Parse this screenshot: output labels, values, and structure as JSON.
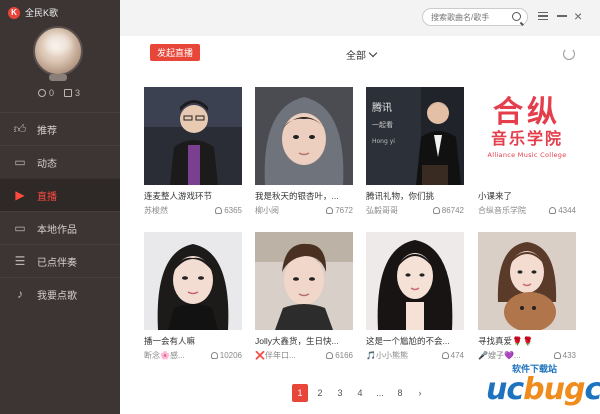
{
  "app": {
    "title": "全民K歌"
  },
  "profile": {
    "stats": [
      {
        "icon": "coin-icon",
        "value": "0"
      },
      {
        "icon": "flower-icon",
        "value": "3"
      }
    ]
  },
  "nav": [
    {
      "label": "推荐",
      "icon": "thumb-up-icon",
      "active": false
    },
    {
      "label": "动态",
      "icon": "chat-icon",
      "active": false
    },
    {
      "label": "直播",
      "icon": "live-video-icon",
      "active": true
    },
    {
      "label": "本地作品",
      "icon": "monitor-icon",
      "active": false
    },
    {
      "label": "已点伴奏",
      "icon": "list-icon",
      "active": false
    },
    {
      "label": "我要点歌",
      "icon": "mic-icon",
      "active": false
    }
  ],
  "search": {
    "placeholder": "搜索歌曲名/歌手"
  },
  "toolbar": {
    "live_button": "发起直播",
    "filter": "全部"
  },
  "cards": [
    {
      "title": "连麦整人游戏环节",
      "user": "苏梭然",
      "count": "6365"
    },
    {
      "title": "我是秋天的银杏叶，...",
      "user": "柳小阅",
      "count": "7672"
    },
    {
      "title": "腾讯礼物，你们挑",
      "user": "弘毅哥哥",
      "count": "86742"
    },
    {
      "title": "小课来了",
      "user": "合纵音乐学院",
      "count": "4344"
    },
    {
      "title": "播一会有人嘛",
      "user": "断念🌸感...",
      "count": "10206"
    },
    {
      "title": "Jolly大鑫货，生日快...",
      "user": "❌伴年口...",
      "count": "6166"
    },
    {
      "title": "这是一个尴尬的不会...",
      "user": "🎵小小熊熊",
      "count": "474"
    },
    {
      "title": "寻找真爱🌹🌹",
      "user": "🎤嫂子💜...",
      "count": "433"
    }
  ],
  "logo_text": {
    "cn": "合纵",
    "sub": "音乐学院",
    "en": "Alliance Music College"
  },
  "pagination": {
    "pages": [
      "1",
      "2",
      "3",
      "4",
      "...",
      "8",
      "›"
    ],
    "active": "1"
  },
  "watermark": {
    "top": "软件下载站",
    "main_u": "uc",
    "main_g": "bug",
    "main_c": "cc"
  },
  "colors": {
    "accent": "#e9463a",
    "sidebar": "#3c3534",
    "watermark_blue": "#1e73be",
    "watermark_orange": "#f08c1c"
  }
}
